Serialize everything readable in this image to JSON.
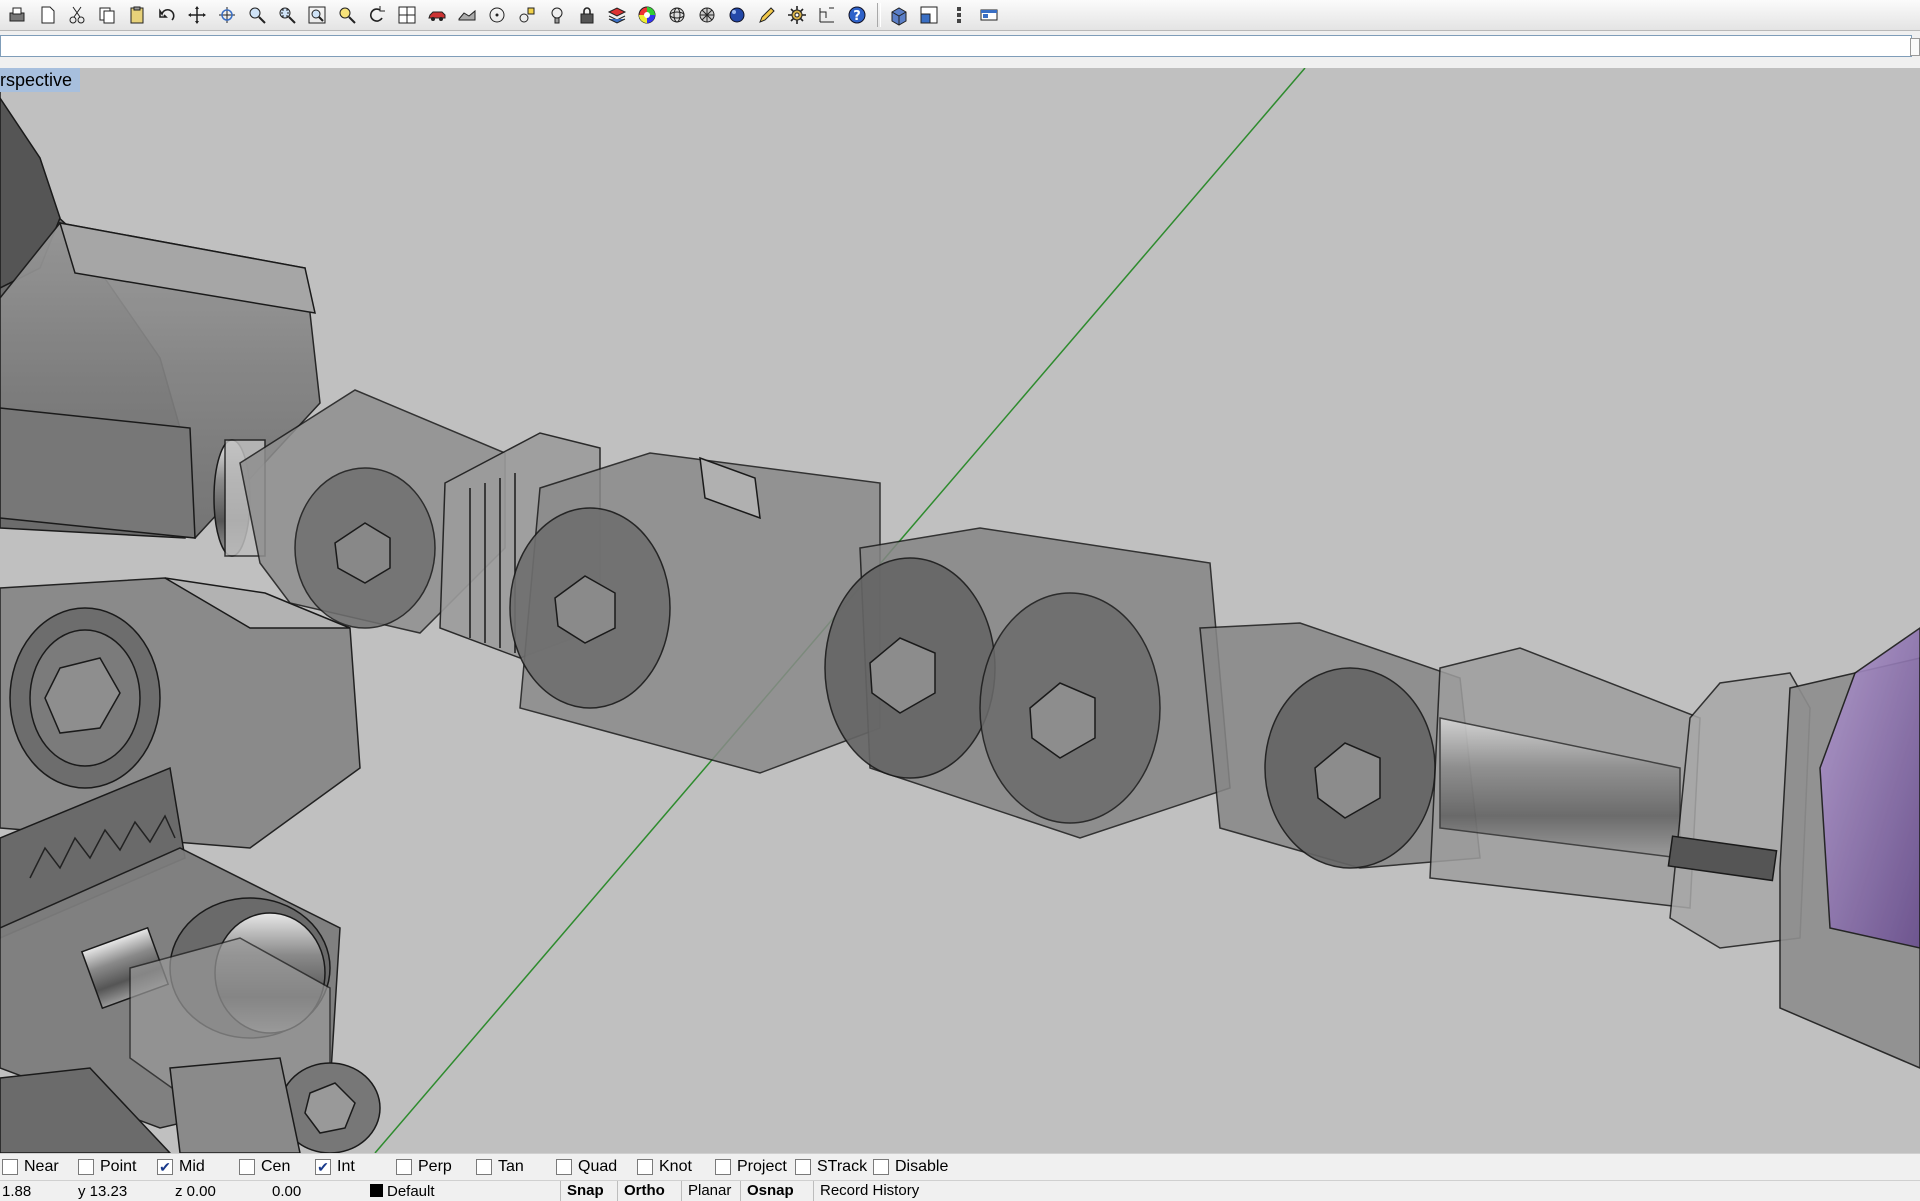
{
  "toolbar": {
    "icons": [
      "print-icon",
      "new-icon",
      "cut-icon",
      "copy-icon",
      "paste-icon",
      "undo-icon",
      "pan-icon",
      "rotate-view-icon",
      "zoom-icon",
      "zoom-window-icon",
      "zoom-extents-icon",
      "zoom-selected-icon",
      "undo-view-icon",
      "four-viewports-icon",
      "car-icon",
      "shaded-icon",
      "circle-icon",
      "snap-icon",
      "light-bulb-icon",
      "lock-icon",
      "layer-icon",
      "color-wheel-icon",
      "sphere-wire-icon",
      "sphere-mesh-icon",
      "sphere-render-icon",
      "pencil-icon",
      "gear-icon",
      "dimension-icon",
      "help-icon",
      "box-icon",
      "viewport-layout-icon",
      "vertical-dots-icon",
      "window-icon"
    ]
  },
  "command": {
    "value": "",
    "placeholder": ""
  },
  "viewport": {
    "title": "rspective",
    "background": "#c0c0c0",
    "axis_color": "#2e8b2e",
    "accent_purple": "#8a6ea8"
  },
  "osnap": {
    "items": [
      {
        "label": "Near",
        "checked": false
      },
      {
        "label": "Point",
        "checked": false
      },
      {
        "label": "Mid",
        "checked": true
      },
      {
        "label": "Cen",
        "checked": false
      },
      {
        "label": "Int",
        "checked": true
      },
      {
        "label": "Perp",
        "checked": false
      },
      {
        "label": "Tan",
        "checked": false
      },
      {
        "label": "Quad",
        "checked": false
      },
      {
        "label": "Knot",
        "checked": false
      },
      {
        "label": "Project",
        "checked": false
      },
      {
        "label": "STrack",
        "checked": false
      },
      {
        "label": "Disable",
        "checked": false
      }
    ]
  },
  "status": {
    "x": "1.88",
    "y": "y 13.23",
    "z": "z 0.00",
    "dist": "0.00",
    "layer": "Default",
    "panes": [
      {
        "label": "Snap",
        "active": true
      },
      {
        "label": "Ortho",
        "active": true
      },
      {
        "label": "Planar",
        "active": false
      },
      {
        "label": "Osnap",
        "active": true
      },
      {
        "label": "Record History",
        "active": false
      }
    ]
  }
}
